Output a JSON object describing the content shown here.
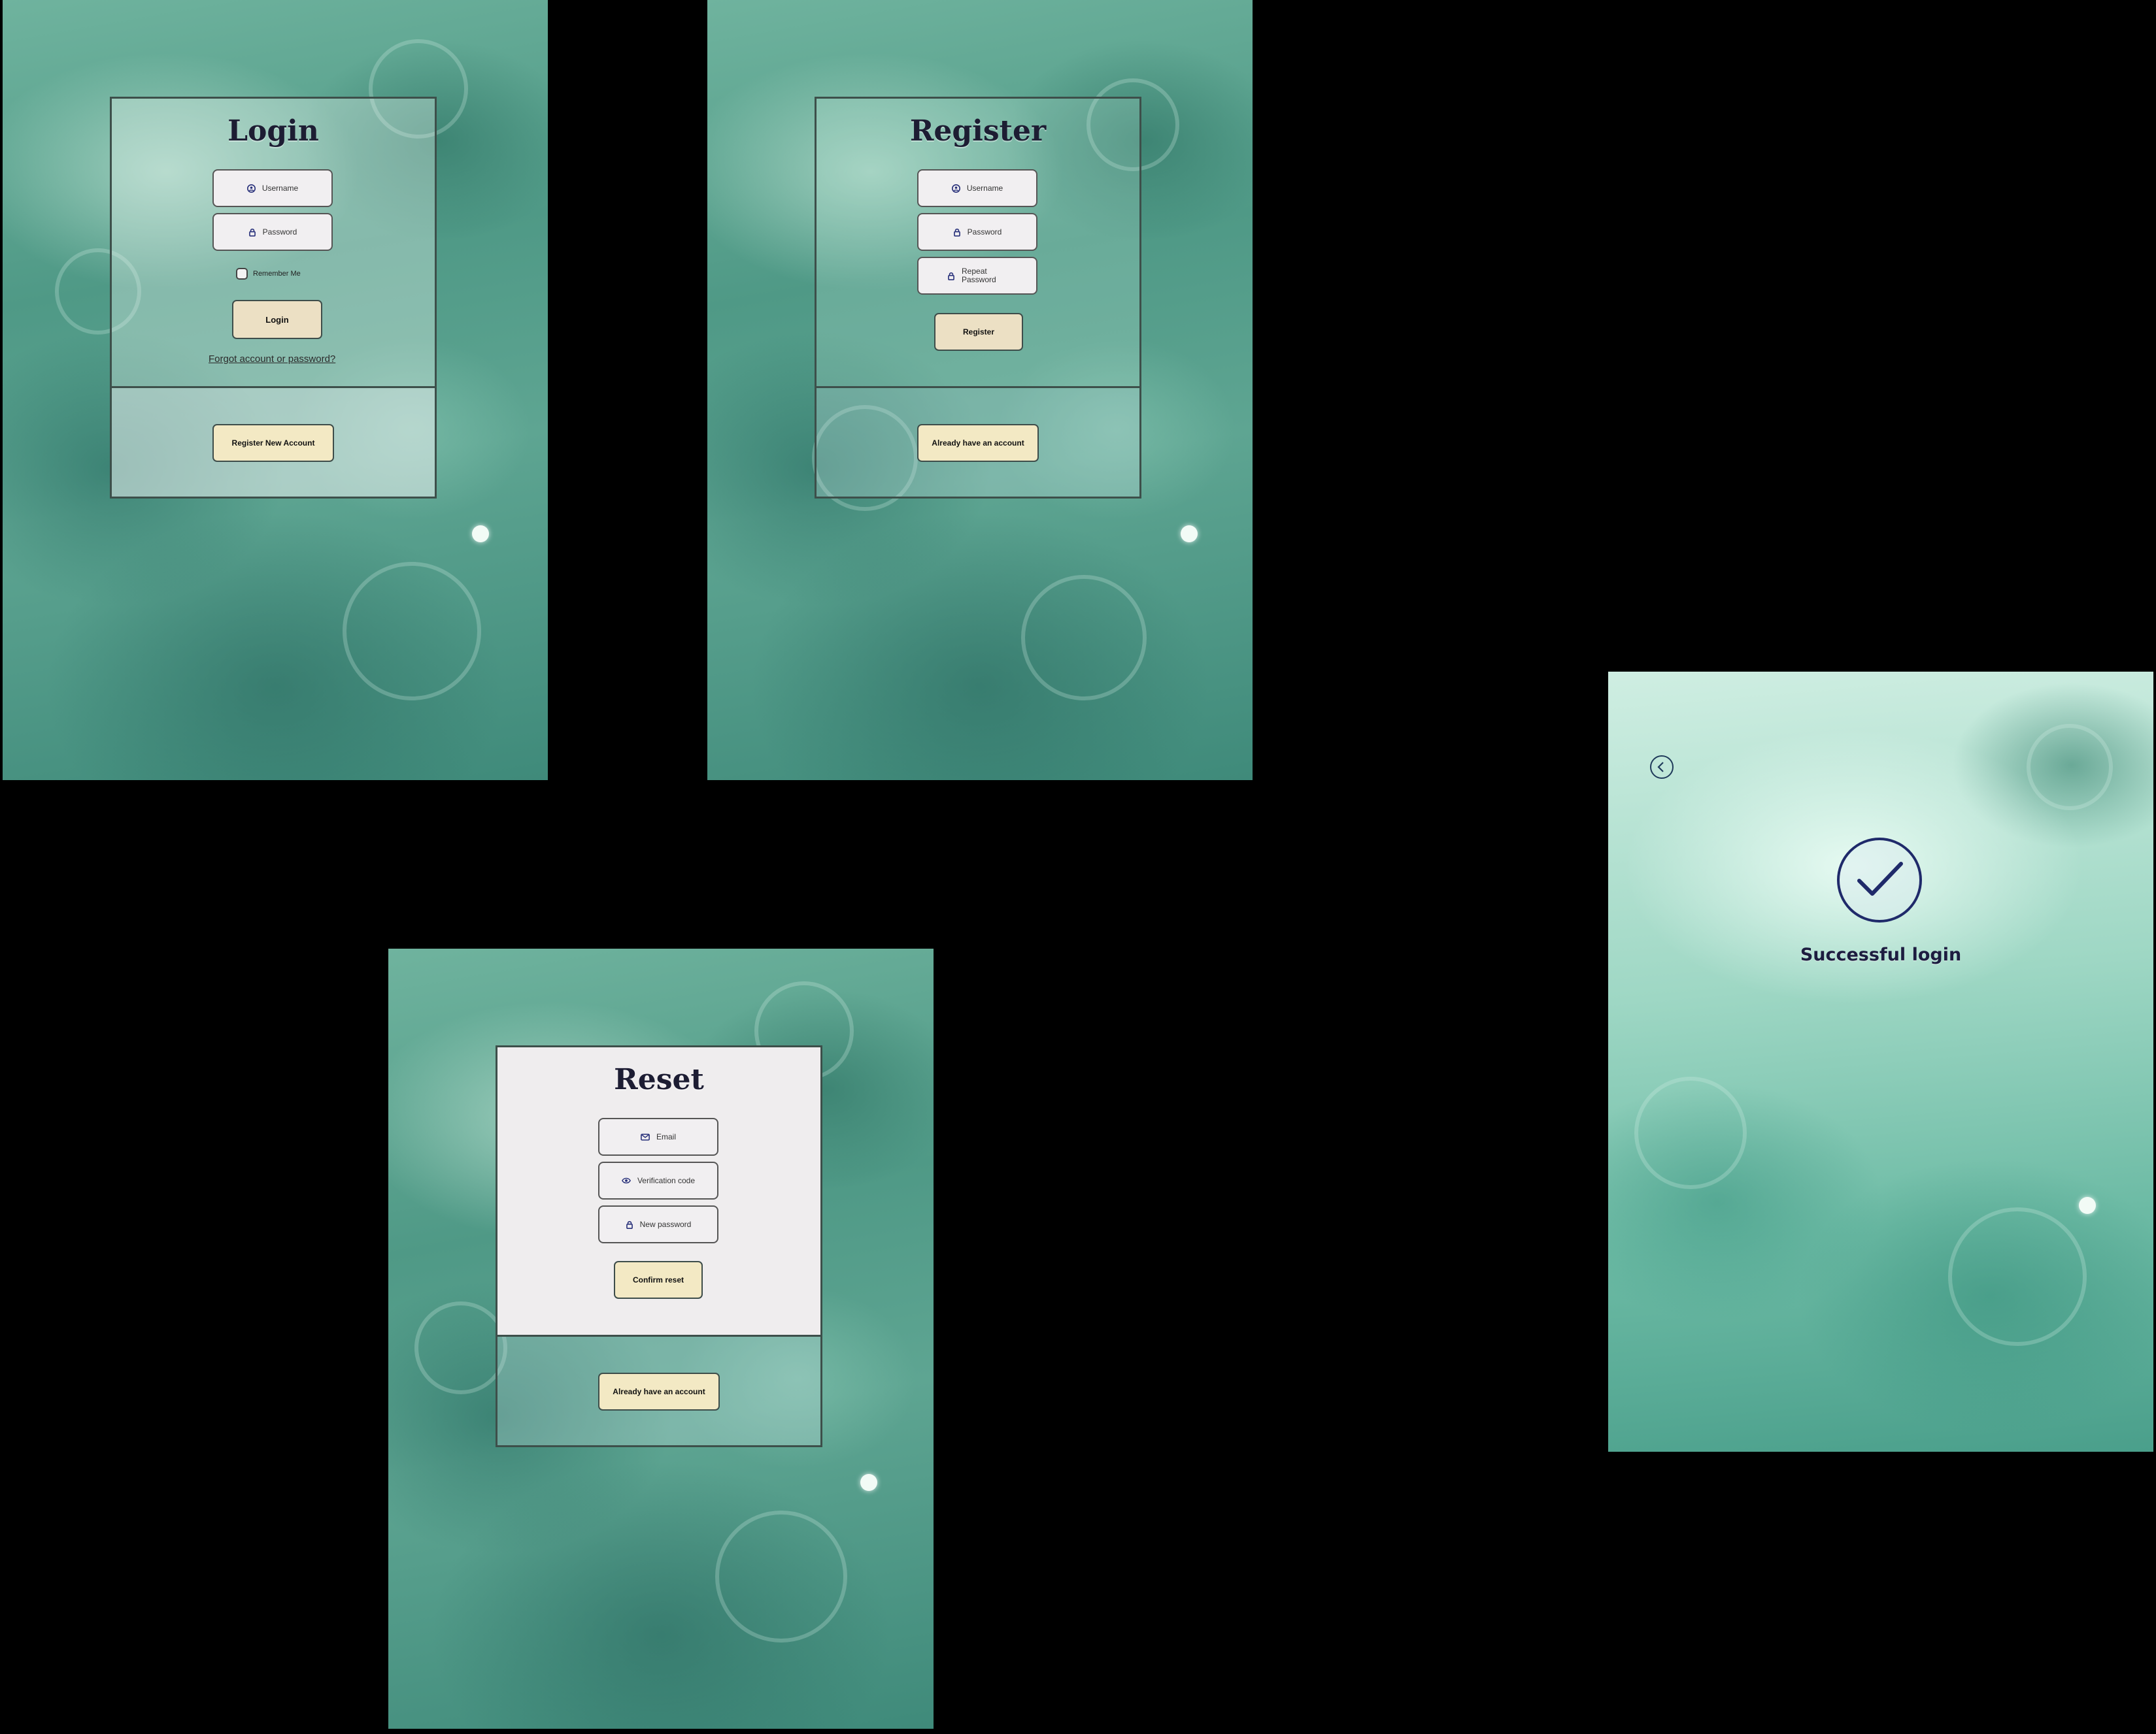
{
  "login": {
    "title": "Login",
    "username_placeholder": "Username",
    "password_placeholder": "Password",
    "remember_label": "Remember Me",
    "login_button": "Login",
    "forgot_link": "Forgot account or password?",
    "register_button": "Register New Account"
  },
  "register": {
    "title": "Register",
    "username_placeholder": "Username",
    "password_placeholder": "Password",
    "repeat_password_placeholder": "Repeat Password",
    "register_button": "Register",
    "have_account_button": "Already have an account"
  },
  "reset": {
    "title": "Reset",
    "email_placeholder": "Email",
    "code_placeholder": "Verification code",
    "new_password_placeholder": "New password",
    "confirm_button": "Confirm reset",
    "have_account_button": "Already have an account"
  },
  "success": {
    "message": "Successful login"
  },
  "icons": {
    "username": "user-circle-icon",
    "password": "lock-icon",
    "email": "mail-icon",
    "code": "eye-icon",
    "back": "chevron-left-icon",
    "check": "check-circle-icon"
  },
  "colors": {
    "page_bg": "#000000",
    "title_text": "#1d1d33",
    "button_fill": "#ece0c4",
    "button_alt_fill": "#f3e9c4",
    "icon_accent": "#28307a"
  }
}
